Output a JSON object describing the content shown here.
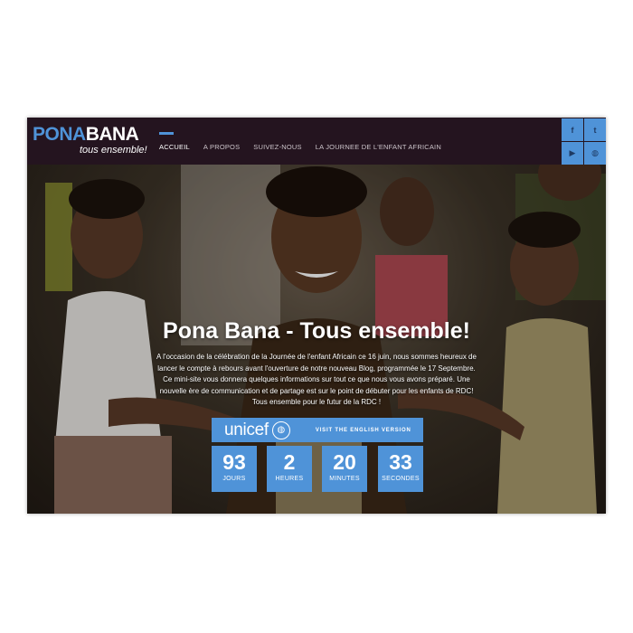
{
  "brand": {
    "word1": "PONA",
    "word2": "BANA",
    "tagline": "tous ensemble!"
  },
  "nav": [
    {
      "label": "ACCUEIL",
      "active": true
    },
    {
      "label": "A PROPOS",
      "active": false
    },
    {
      "label": "SUIVEZ-NOUS",
      "active": false
    },
    {
      "label": "LA JOURNEE DE L'ENFANT AFRICAIN",
      "active": false
    }
  ],
  "social": [
    {
      "icon": "facebook-icon",
      "glyph": "f"
    },
    {
      "icon": "twitter-icon",
      "glyph": "t"
    },
    {
      "icon": "youtube-icon",
      "glyph": "▶"
    },
    {
      "icon": "unicef-icon",
      "glyph": "◍"
    }
  ],
  "hero": {
    "title": "Pona Bana - Tous ensemble!",
    "lines": [
      "A l'occasion de la célébration de la Journée de l'enfant Africain ce 16 juin, nous sommes heureux de",
      "lancer le compte à rebours avant l'ouverture de notre nouveau Blog, programmée le 17 Septembre.",
      "Ce mini-site vous donnera quelques informations sur tout ce que nous vous avons préparé. Une",
      "nouvelle ère de communication et de partage est sur le point de débuter pour les enfants de RDC!",
      "Tous ensemble pour le futur de la RDC !"
    ]
  },
  "unicef": {
    "name": "unicef",
    "visit_label": "VISIT THE ENGLISH VERSION"
  },
  "countdown": [
    {
      "value": "93",
      "label": "JOURS"
    },
    {
      "value": "2",
      "label": "HEURES"
    },
    {
      "value": "20",
      "label": "MINUTES"
    },
    {
      "value": "33",
      "label": "SECONDES"
    }
  ],
  "colors": {
    "accent": "#4f93d8",
    "header_bg": "#24141f",
    "text_on_dark": "#ffffff"
  }
}
